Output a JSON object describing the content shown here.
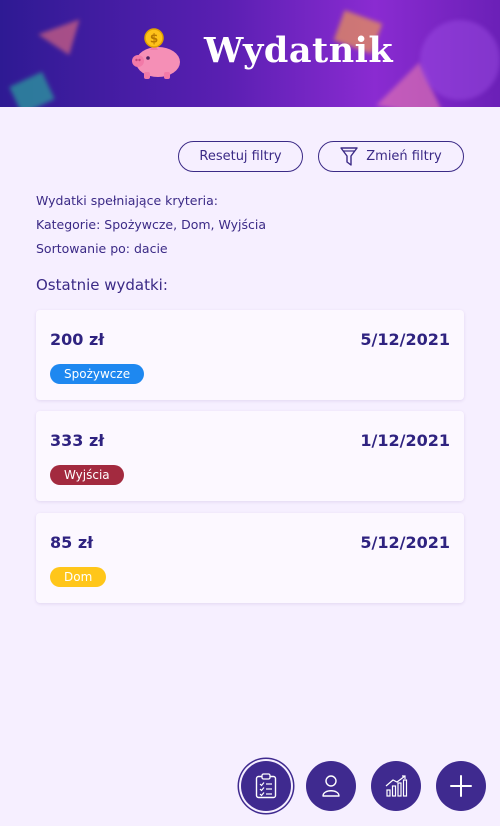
{
  "header": {
    "title": "Wydatnik",
    "coin_symbol": "$"
  },
  "filters": {
    "reset_label": "Resetuj filtry",
    "change_label": "Zmień filtry"
  },
  "criteria": {
    "heading": "Wydatki spełniające kryteria:",
    "categories_line": "Kategorie: Spożywcze, Dom, Wyjścia",
    "sort_line": "Sortowanie po: dacie"
  },
  "expenses_title": "Ostatnie wydatki:",
  "expenses": [
    {
      "amount": "200 zł",
      "date": "5/12/2021",
      "category": "Spożywcze",
      "color": "#1e88f0"
    },
    {
      "amount": "333 zł",
      "date": "1/12/2021",
      "category": "Wyjścia",
      "color": "#a32a3f"
    },
    {
      "amount": "85 zł",
      "date": "5/12/2021",
      "category": "Dom",
      "color": "#ffc61a"
    }
  ],
  "nav": {
    "items": [
      {
        "icon": "clipboard-list-icon",
        "active": true
      },
      {
        "icon": "user-icon",
        "active": false
      },
      {
        "icon": "chart-icon",
        "active": false
      },
      {
        "icon": "plus-icon",
        "active": false
      }
    ]
  },
  "colors": {
    "primary": "#3b2a86",
    "background": "#f6efff",
    "header_start": "#2e1a93",
    "header_end": "#8a2bd1"
  }
}
